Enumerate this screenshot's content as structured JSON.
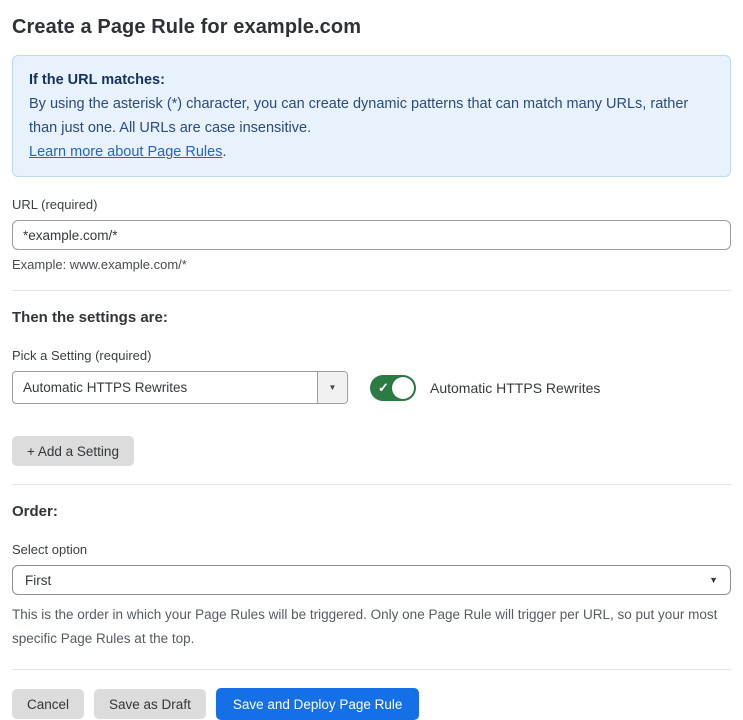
{
  "page": {
    "title": "Create a Page Rule for example.com"
  },
  "info_box": {
    "heading": "If the URL matches:",
    "body": "By using the asterisk (*) character, you can create dynamic patterns that can match many URLs, rather than just one. All URLs are case insensitive.",
    "link_label": "Learn more about Page Rules",
    "link_suffix": "."
  },
  "url_field": {
    "label": "URL (required)",
    "value": "*example.com/*",
    "helper": "Example: www.example.com/*"
  },
  "settings_section": {
    "heading": "Then the settings are:",
    "picker_label": "Pick a Setting (required)",
    "picker_value": "Automatic HTTPS Rewrites",
    "picker_arrow": "▼",
    "toggle_state": "on",
    "toggle_check": "✓",
    "toggle_label": "Automatic HTTPS Rewrites",
    "add_button_label": "+ Add a Setting"
  },
  "order_section": {
    "heading": "Order:",
    "select_label": "Select option",
    "select_value": "First",
    "select_arrow": "▼",
    "helper": "This is the order in which your Page Rules will be triggered. Only one Page Rule will trigger per URL, so put your most specific Page Rules at the top."
  },
  "footer": {
    "cancel_label": "Cancel",
    "save_draft_label": "Save as Draft",
    "save_deploy_label": "Save and Deploy Page Rule"
  },
  "colors": {
    "info_bg": "#e8f2fc",
    "info_border": "#bedaf3",
    "info_text": "#2b4a7e",
    "info_heading": "#15325f",
    "link_blue": "#2364c9",
    "accent_blue": "#1570e8",
    "toggle_green": "#2c7b44",
    "button_gray": "#dcdcdc"
  }
}
